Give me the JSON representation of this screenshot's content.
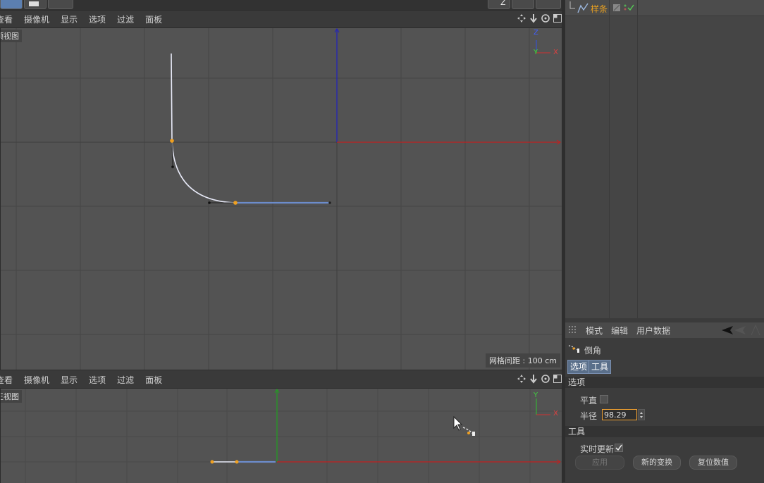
{
  "toolbar": {
    "z_label": "Z"
  },
  "top_view": {
    "menu": [
      "查看",
      "摄像机",
      "显示",
      "选项",
      "过滤",
      "面板"
    ],
    "label": "顶视图",
    "grid_info": "网格间距 : 100 cm",
    "axis_labels": {
      "z": "Z",
      "y": "Y",
      "x": "X"
    }
  },
  "front_view": {
    "menu": [
      "查看",
      "摄像机",
      "显示",
      "选项",
      "过滤",
      "面板"
    ],
    "label": "正视图",
    "axis_labels": {
      "y": "Y",
      "x": "X"
    }
  },
  "object_manager": {
    "object_name": "样条",
    "accent": "#e8a020"
  },
  "attributes": {
    "menu": [
      "模式",
      "编辑",
      "用户数据"
    ],
    "tool_name": "倒角",
    "tabs": [
      "选项",
      "工具"
    ],
    "section_options": "选项",
    "flat_label": "平直",
    "flat_checked": false,
    "radius_label": "半径",
    "radius_value": "98.29 cm",
    "section_tool": "工具",
    "realtime_label": "实时更新",
    "realtime_checked": true,
    "apply_button": "应用",
    "new_transform_button": "新的变换",
    "reset_button": "复位数值"
  }
}
